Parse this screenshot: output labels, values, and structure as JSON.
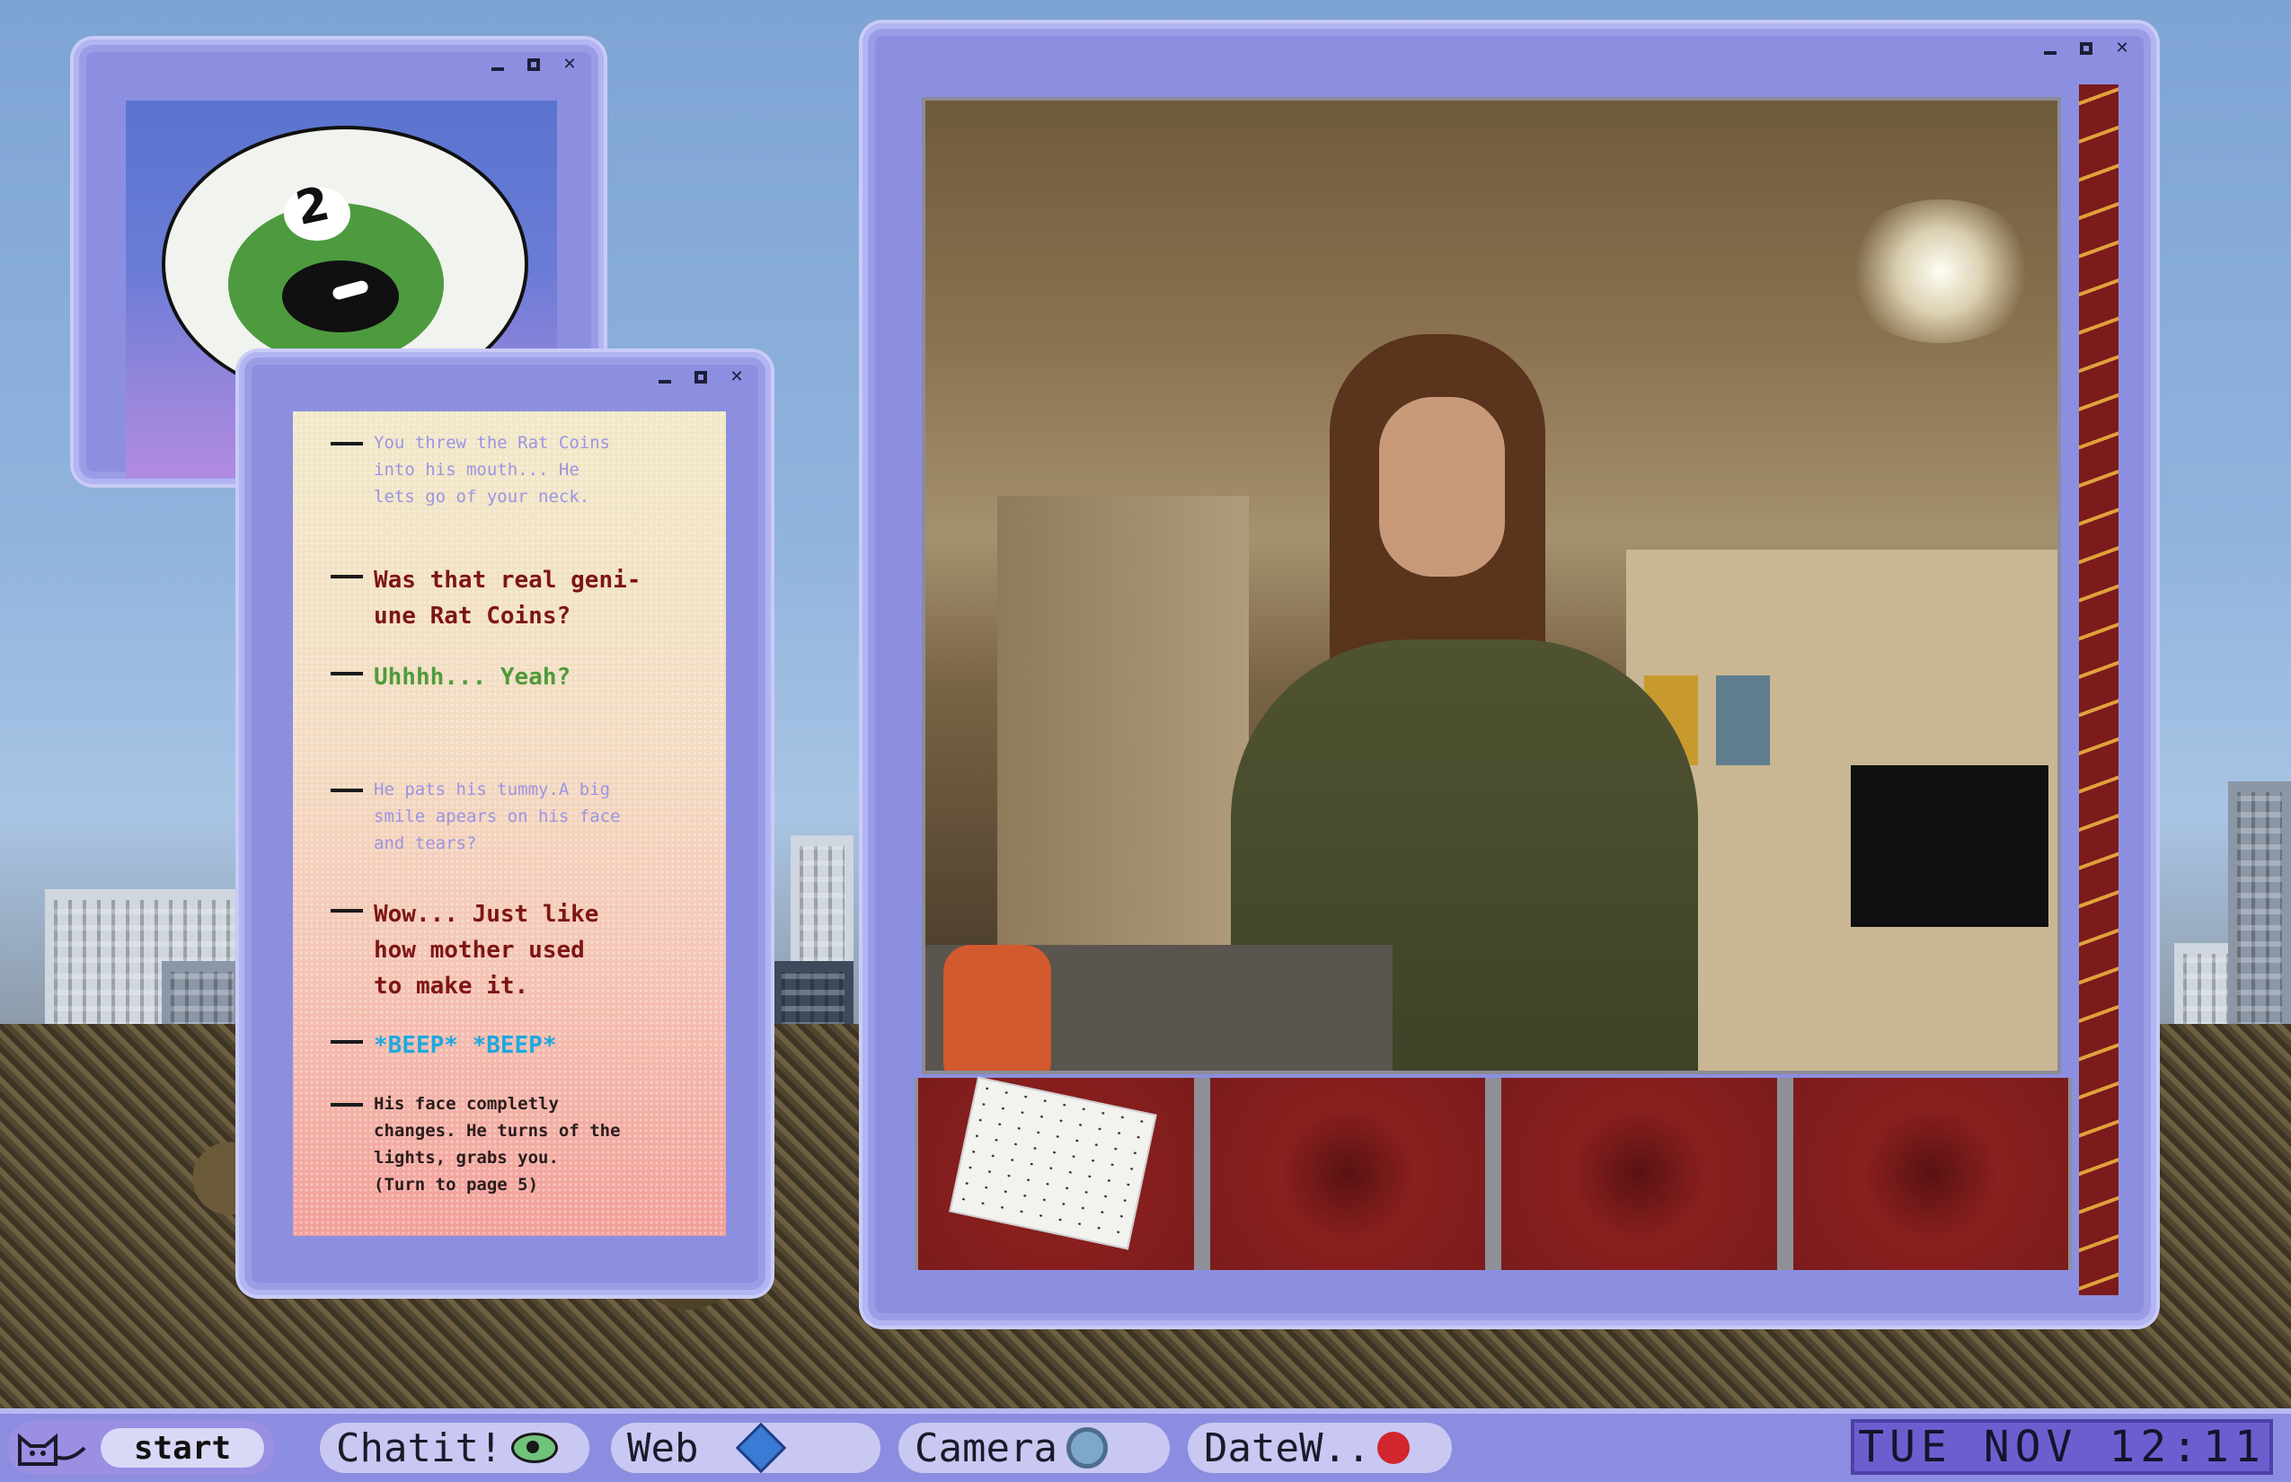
{
  "eye_window": {
    "count": "2"
  },
  "chat": {
    "messages": [
      {
        "text": "You threw the Rat Coins\ninto his mouth... He\nlets go of your neck."
      },
      {
        "text": "Was that real geni-\nune Rat Coins?"
      },
      {
        "text": "Uhhhh... Yeah?"
      },
      {
        "text": "He pats his tummy.A big\nsmile apears on his face\nand tears?"
      },
      {
        "text": "Wow... Just like\nhow mother used\nto make it."
      },
      {
        "text": "*BEEP* *BEEP*"
      },
      {
        "text": "His face completly\nchanges. He turns of the\nlights, grabs you.\n(Turn to page 5)"
      }
    ]
  },
  "taskbar": {
    "start_label": "start",
    "items": [
      {
        "label": "Chatit!",
        "icon": "eye-icon"
      },
      {
        "label": "Web",
        "icon": "diamond-icon"
      },
      {
        "label": "Camera",
        "icon": "ring-icon"
      },
      {
        "label": "DateW..",
        "icon": "heart-icon"
      }
    ],
    "clock": "TUE NOV 12:11"
  },
  "colors": {
    "window": "#8c8fe0",
    "taskbar": "#8c8de0",
    "accent_red": "#7b1c1c"
  }
}
